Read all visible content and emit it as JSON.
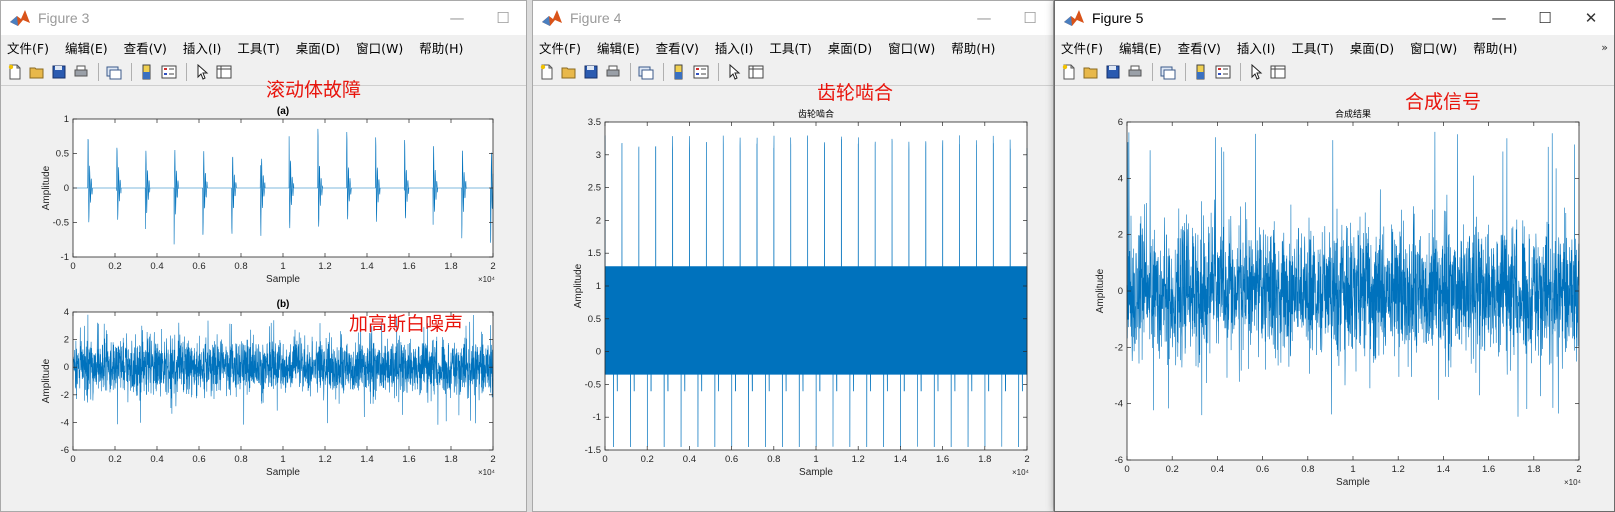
{
  "colors": {
    "line": "#0072bd",
    "annotation": "#e8140c",
    "axes_bg": "#ffffff",
    "figure_bg": "#f0f0f0"
  },
  "menu": [
    "文件(F)",
    "编辑(E)",
    "查看(V)",
    "插入(I)",
    "工具(T)",
    "桌面(D)",
    "窗口(W)",
    "帮助(H)"
  ],
  "toolbar_icons": [
    "new-file-icon",
    "open-folder-icon",
    "save-icon",
    "print-icon",
    "link-figure-icon",
    "colorbar-icon",
    "legend-icon",
    "pointer-icon",
    "property-inspector-icon"
  ],
  "window_buttons": {
    "minimize": "—",
    "maximize": "☐",
    "close": "✕"
  },
  "windows": [
    {
      "title": "Figure 3",
      "annotations": [
        "滚动体故障",
        "加高斯白噪声"
      ],
      "axes": [
        {
          "title": "(a)",
          "xlabel": "Sample",
          "ylabel": "Amplitude",
          "xticks": [
            "0",
            "0.2",
            "0.4",
            "0.6",
            "0.8",
            "1",
            "1.2",
            "1.4",
            "1.6",
            "1.8",
            "2"
          ],
          "yticks": [
            "1",
            "0.5",
            "0",
            "-0.5",
            "-1"
          ],
          "exponent": "×10⁴"
        },
        {
          "title": "(b)",
          "xlabel": "Sample",
          "ylabel": "Amplitude",
          "xticks": [
            "0",
            "0.2",
            "0.4",
            "0.6",
            "0.8",
            "1",
            "1.2",
            "1.4",
            "1.6",
            "1.8",
            "2"
          ],
          "yticks": [
            "4",
            "2",
            "0",
            "-2",
            "-4",
            "-6"
          ],
          "exponent": "×10⁴"
        }
      ]
    },
    {
      "title": "Figure 4",
      "annotations": [
        "齿轮啮合"
      ],
      "axes": [
        {
          "title": "齿轮啮合",
          "xlabel": "Sample",
          "ylabel": "Amplitude",
          "xticks": [
            "0",
            "0.2",
            "0.4",
            "0.6",
            "0.8",
            "1",
            "1.2",
            "1.4",
            "1.6",
            "1.8",
            "2"
          ],
          "yticks": [
            "3.5",
            "3",
            "2.5",
            "2",
            "1.5",
            "1",
            "0.5",
            "0",
            "-0.5",
            "-1",
            "-1.5"
          ],
          "exponent": "×10⁴"
        }
      ]
    },
    {
      "title": "Figure 5",
      "annotations": [
        "合成信号"
      ],
      "overflow_chevron": "»",
      "axes": [
        {
          "title": "合成结果",
          "xlabel": "Sample",
          "ylabel": "Amplitude",
          "xticks": [
            "0",
            "0.2",
            "0.4",
            "0.6",
            "0.8",
            "1",
            "1.2",
            "1.4",
            "1.6",
            "1.8",
            "2"
          ],
          "yticks": [
            "6",
            "4",
            "2",
            "0",
            "-2",
            "-4",
            "-6"
          ],
          "exponent": "×10⁴"
        }
      ]
    }
  ],
  "chart_data": [
    {
      "type": "line",
      "window": "Figure 3",
      "title": "(a)",
      "xlabel": "Sample",
      "ylabel": "Amplitude",
      "xlim": [
        0,
        20000
      ],
      "ylim": [
        -1,
        1
      ],
      "x_exponent": 4,
      "series": [
        {
          "pattern": "periodic impulses",
          "period_samples": 1370,
          "peak_amplitude": 0.95
        }
      ]
    },
    {
      "type": "line",
      "window": "Figure 3",
      "title": "(b)",
      "xlabel": "Sample",
      "ylabel": "Amplitude",
      "xlim": [
        0,
        20000
      ],
      "ylim": [
        -6,
        4
      ],
      "x_exponent": 4,
      "series": [
        {
          "pattern": "gaussian white noise",
          "typical_range": [
            -2,
            2
          ],
          "extremes": [
            -4.2,
            3.4
          ]
        }
      ]
    },
    {
      "type": "line",
      "window": "Figure 4",
      "title": "齿轮啮合",
      "xlabel": "Sample",
      "ylabel": "Amplitude",
      "xlim": [
        0,
        20000
      ],
      "ylim": [
        -1.5,
        3.5
      ],
      "x_exponent": 4,
      "series": [
        {
          "pattern": "gear mesh",
          "period_samples": 800,
          "baseline_range": [
            -0.35,
            1.3
          ],
          "spike_max": 3.3,
          "spike_min": -1.45
        }
      ]
    },
    {
      "type": "line",
      "window": "Figure 5",
      "title": "合成结果",
      "xlabel": "Sample",
      "ylabel": "Amplitude",
      "xlim": [
        0,
        20000
      ],
      "ylim": [
        -6,
        6
      ],
      "x_exponent": 4,
      "series": [
        {
          "pattern": "composite signal",
          "typical_range": [
            -2.5,
            2.5
          ],
          "extremes": [
            -4.5,
            5.8
          ]
        }
      ]
    }
  ]
}
